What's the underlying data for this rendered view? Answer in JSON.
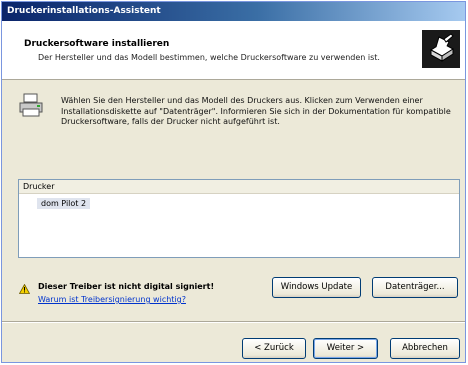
{
  "window": {
    "title": "Druckerinstallations-Assistent"
  },
  "header": {
    "title": "Druckersoftware installieren",
    "subtitle": "Der Hersteller und das Modell bestimmen, welche Druckersoftware zu verwenden ist.",
    "icon": "printer-wizard-icon"
  },
  "intro": {
    "icon": "printer-icon",
    "text": "Wählen Sie den Hersteller und das Modell des Druckers aus. Klicken zum Verwenden einer Installationsdiskette auf \"Datenträger\". Informieren Sie sich in der Dokumentation für kompatible Druckersoftware, falls der Drucker nicht aufgeführt ist."
  },
  "printer_list": {
    "header": "Drucker",
    "items": [
      "dom Pilot 2"
    ]
  },
  "warning": {
    "icon": "warning-icon",
    "text": "Dieser Treiber ist nicht digital signiert!",
    "link": "Warum ist Treibersignierung wichtig?"
  },
  "buttons": {
    "windows_update": "Windows Update",
    "have_disk": "Datenträger...",
    "back": "< Zurück",
    "next": "Weiter >",
    "cancel": "Abbrechen"
  }
}
